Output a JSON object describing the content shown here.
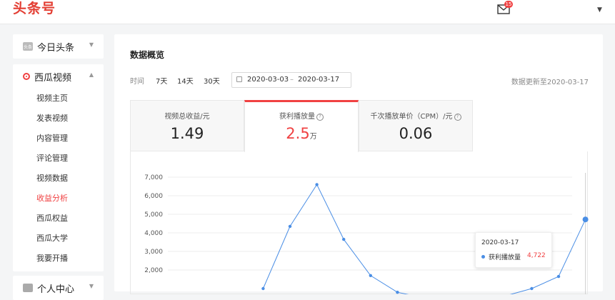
{
  "app": {
    "logo": "头条号",
    "mail_badge": "15"
  },
  "sidebar": {
    "home": {
      "label": "今日头条",
      "icon_text": "头条"
    },
    "xigua": {
      "label": "西瓜视频",
      "items": [
        {
          "label": "视频主页"
        },
        {
          "label": "发表视频"
        },
        {
          "label": "内容管理"
        },
        {
          "label": "评论管理"
        },
        {
          "label": "视频数据"
        },
        {
          "label": "收益分析",
          "active": true
        },
        {
          "label": "西瓜权益"
        },
        {
          "label": "西瓜大学"
        },
        {
          "label": "我要开播"
        }
      ]
    },
    "personal": {
      "label": "个人中心"
    }
  },
  "main": {
    "title": "数据概览",
    "time_label": "时间",
    "periods": [
      "7天",
      "14天",
      "30天"
    ],
    "date_start": "2020-03-03",
    "date_sep": "–",
    "date_end": "2020-03-17",
    "update_note": "数据更新至2020-03-17",
    "stats": [
      {
        "label": "视频总收益/元",
        "value": "1.49",
        "unit": ""
      },
      {
        "label": "获利播放量",
        "value": "2.5",
        "unit": "万"
      },
      {
        "label": "千次播放单价（CPM）/元",
        "value": "0.06",
        "unit": ""
      }
    ]
  },
  "tooltip": {
    "date": "2020-03-17",
    "series": "获利播放量",
    "value": "4,722"
  },
  "colors": {
    "accent": "#f04142",
    "line": "#4a8ee5"
  },
  "chart_data": {
    "type": "line",
    "series": [
      {
        "name": "获利播放量",
        "values": [
          null,
          null,
          null,
          null,
          1000,
          4350,
          6600,
          3650,
          1700,
          800,
          500,
          400,
          450,
          600,
          1000,
          1650,
          4722
        ]
      }
    ],
    "y_ticks": [
      "7,000",
      "6,000",
      "5,000",
      "4,000",
      "3,000",
      "2,000"
    ],
    "ylim": [
      0,
      7000
    ],
    "grid": true
  }
}
